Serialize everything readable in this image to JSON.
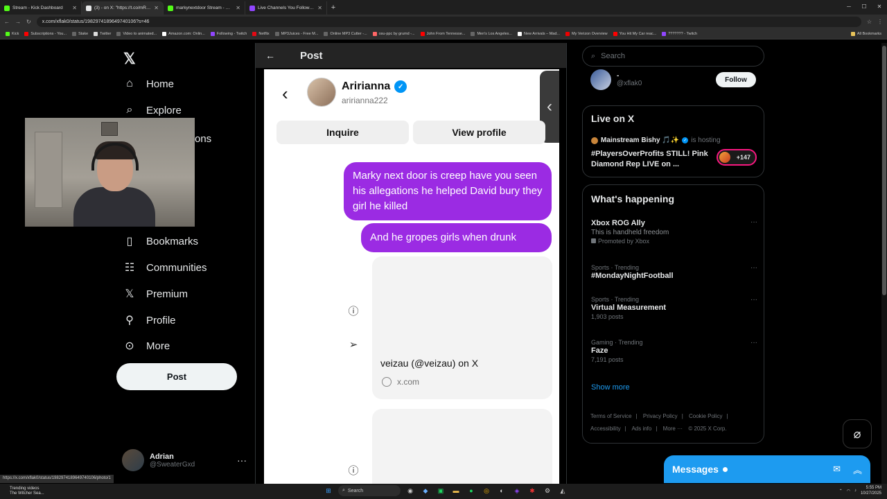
{
  "browser": {
    "tabs": [
      {
        "title": "Stream - Kick Dashboard",
        "color": "#53fc18"
      },
      {
        "title": "(3) - on X: \"https://t.co/mR9B...",
        "color": "#e7e9ea"
      },
      {
        "title": "markynextdoor Stream - Watch",
        "color": "#53fc18"
      },
      {
        "title": "Live Channels You Follow - Twitch",
        "color": "#9146ff"
      }
    ],
    "url": "x.com/xflak0/status/1982974189649740106?s=46",
    "bookmarks": [
      "Kick",
      "Subscriptions - You...",
      "Stake",
      "Twitter",
      "Video to animated...",
      "Amazon.com: Onlin...",
      "Following - Twitch",
      "Netflix",
      "MP3Juices - Free M...",
      "Online MP3 Cutter -...",
      "osu-ppc by grumd -...",
      "John From Tennesse...",
      "Men's Los Angeles...",
      "New Arrivals – Mad...",
      "My Verizon Overview",
      "You Hit My Car reac...",
      "??????? - Twitch",
      "All Bookmarks"
    ],
    "status_url": "https://x.com/xflak0/status/1982974189649740106/photo/1"
  },
  "leftnav": {
    "items": [
      {
        "label": "Home",
        "icon": "home-icon"
      },
      {
        "label": "Explore",
        "icon": "search-icon"
      },
      {
        "label": "Bookmarks",
        "icon": "bookmark-icon"
      },
      {
        "label": "Communities",
        "icon": "communities-icon"
      },
      {
        "label": "Premium",
        "icon": "x-logo-icon"
      },
      {
        "label": "Profile",
        "icon": "person-icon"
      },
      {
        "label": "More",
        "icon": "more-circle-icon"
      }
    ],
    "partial_label": "ons",
    "post_label": "Post",
    "account": {
      "name": "Adrian",
      "handle": "@SweaterGxd"
    }
  },
  "center": {
    "header_title": "Post",
    "dm": {
      "username": "Aririanna",
      "handle": "aririanna222",
      "inquire": "Inquire",
      "view_profile": "View profile",
      "messages": [
        "Marky next door is creep have you seen his allegations he helped David bury they girl he killed",
        "And he gropes girls when drunk"
      ],
      "link_title": "veizau (@veizau) on X",
      "link_domain": "x.com"
    }
  },
  "right": {
    "search_placeholder": "Search",
    "who": {
      "name": "-",
      "handle": "@xflak0",
      "follow": "Follow"
    },
    "live": {
      "title": "Live on X",
      "host": "Mainstream Bishy 🎵✨",
      "hosting": "is hosting",
      "stream_title": "#PlayersOverProfits STILL! Pink Diamond Rep LIVE on ...",
      "count": "+147"
    },
    "happening": {
      "title": "What's happening",
      "trends": [
        {
          "meta": "",
          "name": "Xbox ROG Ally",
          "sub": "This is handheld freedom",
          "promo": "Promoted by Xbox"
        },
        {
          "meta": "Sports · Trending",
          "name": "#MondayNightFootball",
          "sub": "",
          "promo": ""
        },
        {
          "meta": "Sports · Trending",
          "name": "Virtual Measurement",
          "sub": "1,903 posts",
          "promo": ""
        },
        {
          "meta": "Gaming · Trending",
          "name": "Faze",
          "sub": "7,191 posts",
          "promo": ""
        }
      ],
      "show_more": "Show more"
    },
    "footer": [
      "Terms of Service",
      "|",
      "Privacy Policy",
      "|",
      "Cookie Policy",
      "|",
      "Accessibility",
      "|",
      "Ads info",
      "|",
      "More ···",
      "© 2025 X Corp."
    ]
  },
  "messages_drawer": {
    "label": "Messages"
  },
  "taskbar": {
    "weather_line1": "Trending videos",
    "weather_line2": "The Witcher Sea...",
    "search": "Search",
    "time": "5:55 PM",
    "date": "10/27/2025"
  }
}
